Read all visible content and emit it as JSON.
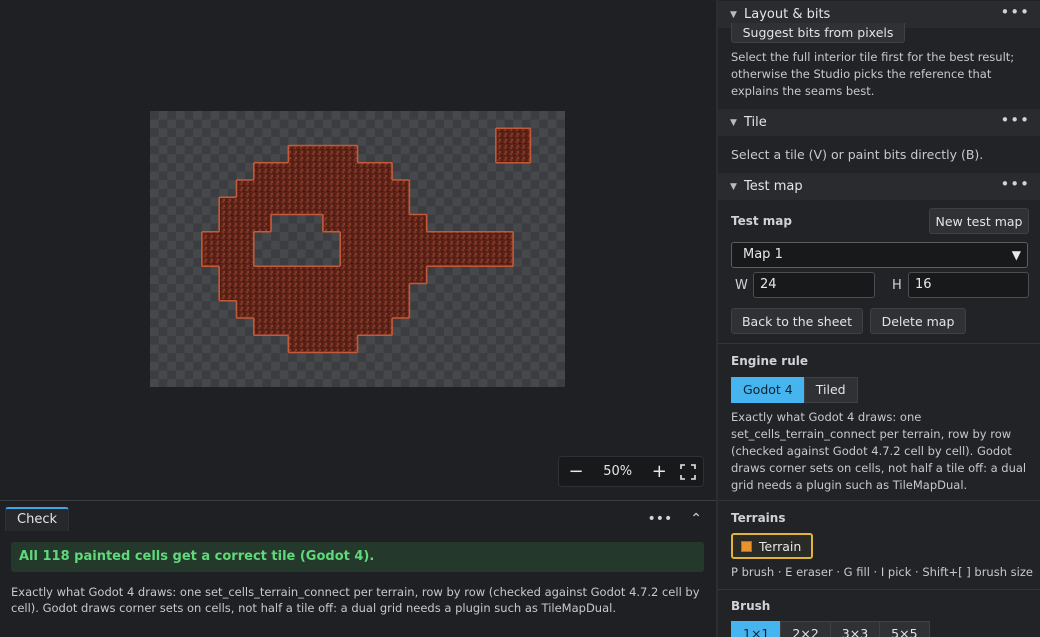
{
  "canvas": {
    "zoom": {
      "minus": "−",
      "value": "50%",
      "plus": "+"
    },
    "map_grid": {
      "cols": 24,
      "rows": 16,
      "cells": [
        [
          8,
          2
        ],
        [
          9,
          2
        ],
        [
          10,
          2
        ],
        [
          11,
          2
        ],
        [
          6,
          3
        ],
        [
          7,
          3
        ],
        [
          8,
          3
        ],
        [
          9,
          3
        ],
        [
          10,
          3
        ],
        [
          11,
          3
        ],
        [
          12,
          3
        ],
        [
          13,
          3
        ],
        [
          5,
          4
        ],
        [
          6,
          4
        ],
        [
          7,
          4
        ],
        [
          8,
          4
        ],
        [
          9,
          4
        ],
        [
          10,
          4
        ],
        [
          11,
          4
        ],
        [
          12,
          4
        ],
        [
          13,
          4
        ],
        [
          14,
          4
        ],
        [
          4,
          5
        ],
        [
          5,
          5
        ],
        [
          6,
          5
        ],
        [
          7,
          5
        ],
        [
          8,
          5
        ],
        [
          9,
          5
        ],
        [
          10,
          5
        ],
        [
          11,
          5
        ],
        [
          12,
          5
        ],
        [
          13,
          5
        ],
        [
          14,
          5
        ],
        [
          4,
          6
        ],
        [
          5,
          6
        ],
        [
          6,
          6
        ],
        [
          10,
          6
        ],
        [
          11,
          6
        ],
        [
          12,
          6
        ],
        [
          13,
          6
        ],
        [
          14,
          6
        ],
        [
          15,
          6
        ],
        [
          3,
          7
        ],
        [
          4,
          7
        ],
        [
          5,
          7
        ],
        [
          11,
          7
        ],
        [
          12,
          7
        ],
        [
          13,
          7
        ],
        [
          14,
          7
        ],
        [
          15,
          7
        ],
        [
          16,
          7
        ],
        [
          17,
          7
        ],
        [
          18,
          7
        ],
        [
          19,
          7
        ],
        [
          20,
          7
        ],
        [
          3,
          8
        ],
        [
          4,
          8
        ],
        [
          5,
          8
        ],
        [
          11,
          8
        ],
        [
          12,
          8
        ],
        [
          13,
          8
        ],
        [
          14,
          8
        ],
        [
          15,
          8
        ],
        [
          16,
          8
        ],
        [
          17,
          8
        ],
        [
          18,
          8
        ],
        [
          19,
          8
        ],
        [
          20,
          8
        ],
        [
          4,
          9
        ],
        [
          5,
          9
        ],
        [
          6,
          9
        ],
        [
          7,
          9
        ],
        [
          8,
          9
        ],
        [
          9,
          9
        ],
        [
          10,
          9
        ],
        [
          11,
          9
        ],
        [
          12,
          9
        ],
        [
          13,
          9
        ],
        [
          14,
          9
        ],
        [
          15,
          9
        ],
        [
          4,
          10
        ],
        [
          5,
          10
        ],
        [
          6,
          10
        ],
        [
          7,
          10
        ],
        [
          8,
          10
        ],
        [
          9,
          10
        ],
        [
          10,
          10
        ],
        [
          11,
          10
        ],
        [
          12,
          10
        ],
        [
          13,
          10
        ],
        [
          14,
          10
        ],
        [
          5,
          11
        ],
        [
          6,
          11
        ],
        [
          7,
          11
        ],
        [
          8,
          11
        ],
        [
          9,
          11
        ],
        [
          10,
          11
        ],
        [
          11,
          11
        ],
        [
          12,
          11
        ],
        [
          13,
          11
        ],
        [
          14,
          11
        ],
        [
          6,
          12
        ],
        [
          7,
          12
        ],
        [
          8,
          12
        ],
        [
          9,
          12
        ],
        [
          10,
          12
        ],
        [
          11,
          12
        ],
        [
          12,
          12
        ],
        [
          13,
          12
        ],
        [
          8,
          13
        ],
        [
          9,
          13
        ],
        [
          10,
          13
        ],
        [
          11,
          13
        ],
        [
          20,
          1
        ],
        [
          21,
          1
        ],
        [
          20,
          2
        ],
        [
          21,
          2
        ]
      ]
    }
  },
  "check": {
    "tab_label": "Check",
    "more": "•••",
    "collapse": "⌃",
    "success": "All 118 painted cells get a correct tile (Godot 4).",
    "description": "Exactly what Godot 4 draws: one set_cells_terrain_connect per terrain, row by row (checked against Godot 4.7.2 cell by cell). Godot draws corner sets on cells, not half a tile off: a dual grid needs a plugin such as TileMapDual."
  },
  "side": {
    "layout_bits": {
      "title": "Layout & bits",
      "suggest_button": "Suggest bits from pixels",
      "hint": "Select the full interior tile first for the best result; otherwise the Studio picks the reference that explains the seams best."
    },
    "tile": {
      "title": "Tile",
      "hint": "Select a tile (V) or paint bits directly (B)."
    },
    "test_map": {
      "title": "Test map",
      "label": "Test map",
      "new_button": "New test map",
      "selected_map": "Map 1",
      "w_label": "W",
      "w_value": "24",
      "h_label": "H",
      "h_value": "16",
      "back_button": "Back to the sheet",
      "delete_button": "Delete map"
    },
    "engine_rule": {
      "label": "Engine rule",
      "options": [
        "Godot 4",
        "Tiled"
      ],
      "description": "Exactly what Godot 4 draws: one set_cells_terrain_connect per terrain, row by row (checked against Godot 4.7.2 cell by cell). Godot draws corner sets on cells, not half a tile off: a dual grid needs a plugin such as TileMapDual."
    },
    "terrains": {
      "label": "Terrains",
      "chip": "Terrain",
      "chip_color": "#e8932d",
      "shortcuts": "P brush · E eraser · G fill · I pick · Shift+[ ] brush size"
    },
    "brush": {
      "label": "Brush",
      "sizes": [
        "1×1",
        "2×2",
        "3×3",
        "5×5"
      ]
    },
    "dots": "•••"
  },
  "colors": {
    "accent": "#46b4ef",
    "success_text": "#5fd97a",
    "terrain_fill": "#6e2a1c",
    "terrain_edge": "#c45a3a"
  }
}
